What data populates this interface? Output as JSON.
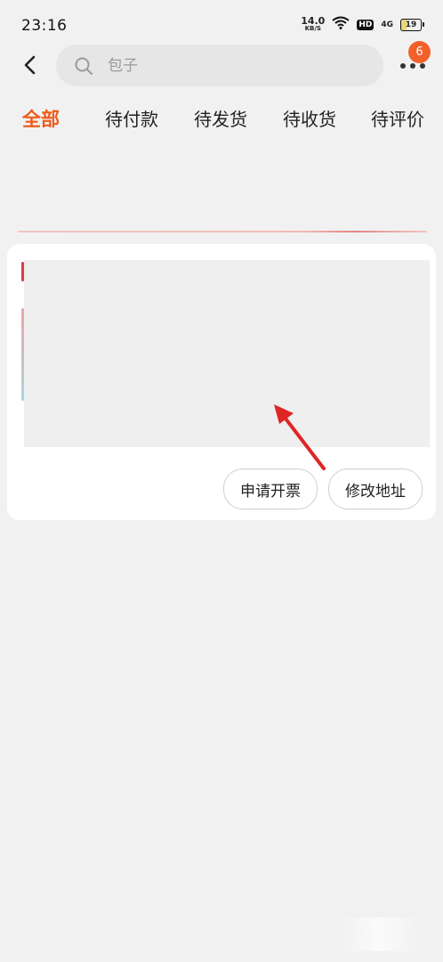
{
  "status_bar": {
    "time": "23:16",
    "net_speed_value": "14.0",
    "net_speed_unit": "KB/S",
    "hd_label": "HD",
    "network_label": "4G",
    "battery_level": "19"
  },
  "header": {
    "search": {
      "placeholder": "包子"
    },
    "notification_count": "6"
  },
  "tabs": [
    {
      "label": "全部",
      "active": true
    },
    {
      "label": "待付款",
      "active": false
    },
    {
      "label": "待发货",
      "active": false
    },
    {
      "label": "待收货",
      "active": false
    },
    {
      "label": "待评价",
      "active": false
    }
  ],
  "order_card": {
    "actions": [
      {
        "label": "申请开票"
      },
      {
        "label": "修改地址"
      }
    ]
  },
  "colors": {
    "accent": "#ef5b1b",
    "badge": "#f2602a",
    "annotation_arrow": "#e02525",
    "background": "#f1f1f1"
  },
  "icons": {
    "back": "chevron-left-icon",
    "search": "search-icon",
    "more": "more-dots-icon",
    "wifi": "wifi-icon",
    "battery": "battery-icon"
  }
}
